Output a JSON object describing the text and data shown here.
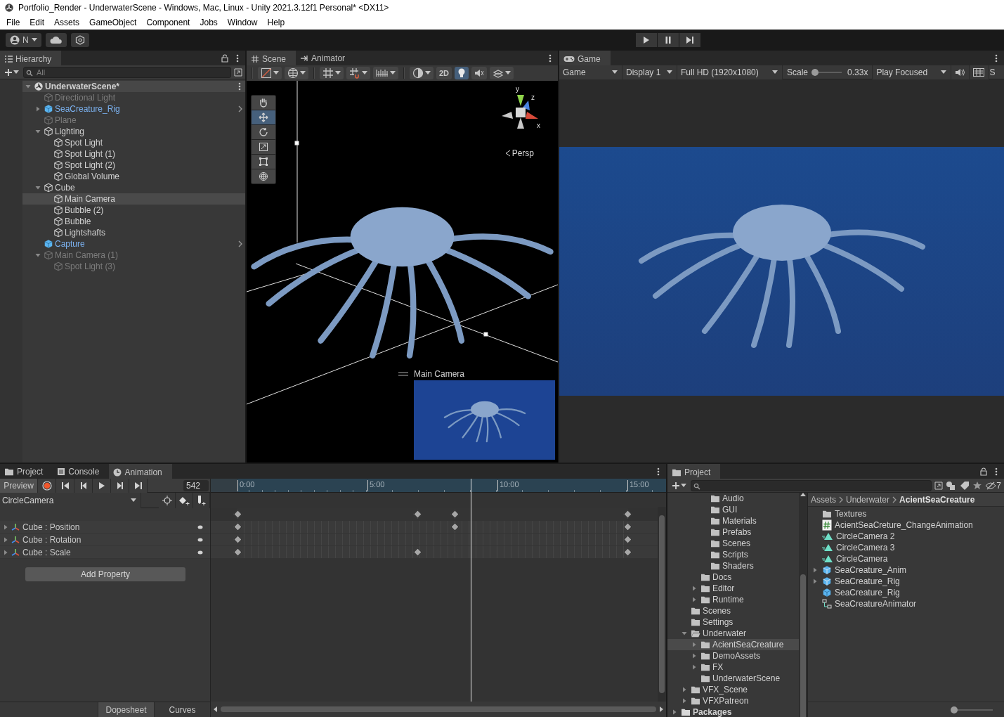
{
  "window": {
    "title": "Portfolio_Render - UnderwaterScene - Windows, Mac, Linux - Unity 2021.3.12f1 Personal* <DX11>"
  },
  "menu": [
    "File",
    "Edit",
    "Assets",
    "GameObject",
    "Component",
    "Jobs",
    "Window",
    "Help"
  ],
  "toolbar": {
    "account": "N",
    "play_controls": [
      {
        "kind": "play"
      },
      {
        "kind": "pause"
      },
      {
        "kind": "step"
      }
    ]
  },
  "hierarchy": {
    "title": "Hierarchy",
    "search": {
      "placeholder": "All"
    },
    "scene": {
      "label": "UnderwaterScene*",
      "expanded": true
    },
    "items": [
      {
        "label": "Directional Light",
        "kind": "object",
        "disabled": true,
        "selected": false
      },
      {
        "label": "SeaCreature_Rig",
        "kind": "prefab",
        "disabled": false,
        "selected": false,
        "expanded": false
      },
      {
        "label": "Plane",
        "kind": "object",
        "disabled": true,
        "selected": false
      },
      {
        "label": "Lighting",
        "kind": "object",
        "disabled": false,
        "selected": false,
        "expanded": true,
        "children": [
          {
            "label": "Spot Light",
            "kind": "object",
            "disabled": false,
            "selected": false
          },
          {
            "label": "Spot Light (1)",
            "kind": "object",
            "disabled": false,
            "selected": false
          },
          {
            "label": "Spot Light (2)",
            "kind": "object",
            "disabled": false,
            "selected": false
          },
          {
            "label": "Global Volume",
            "kind": "object",
            "disabled": false,
            "selected": false
          }
        ]
      },
      {
        "label": "Cube",
        "kind": "object",
        "disabled": false,
        "selected": false,
        "expanded": true,
        "children": [
          {
            "label": "Main Camera",
            "kind": "object",
            "disabled": false,
            "selected": true
          },
          {
            "label": "Bubble (2)",
            "kind": "object",
            "disabled": false,
            "selected": false
          },
          {
            "label": "Bubble",
            "kind": "object",
            "disabled": false,
            "selected": false
          },
          {
            "label": "Lightshafts",
            "kind": "object",
            "disabled": false,
            "selected": false
          }
        ]
      },
      {
        "label": "Capture",
        "kind": "prefab",
        "disabled": false,
        "selected": false
      },
      {
        "label": "Main Camera (1)",
        "kind": "object",
        "disabled": true,
        "selected": false,
        "expanded": true,
        "children": [
          {
            "label": "Spot Light (3)",
            "kind": "object",
            "disabled": true,
            "selected": false
          }
        ]
      }
    ]
  },
  "scene_view": {
    "tabs": [
      {
        "label": "Scene",
        "kind": "scene",
        "selected": true
      },
      {
        "label": "Animator",
        "kind": "animator",
        "selected": false
      }
    ],
    "toolbar": {
      "mode_2d": "2D",
      "lighting_on": true
    },
    "tools": [
      {
        "kind": "hand",
        "selected": false
      },
      {
        "kind": "move",
        "selected": true
      },
      {
        "kind": "rotate",
        "selected": false
      },
      {
        "kind": "scale",
        "selected": false
      },
      {
        "kind": "rect",
        "selected": false
      },
      {
        "kind": "transform",
        "selected": false
      }
    ],
    "gizmo": {
      "axes": [
        "y",
        "z",
        "x"
      ],
      "projection": "Persp"
    },
    "camera_preview": {
      "label": "Main Camera"
    }
  },
  "game_view": {
    "tabs": [
      {
        "label": "Game",
        "selected": true
      }
    ],
    "toolbar": {
      "view": "Game",
      "display": "Display 1",
      "resolution": "Full HD (1920x1080)",
      "scale_label": "Scale",
      "scale": {
        "level": 0.05
      },
      "scale_value": "0.33x",
      "play_mode": "Play Focused",
      "cut_label": "S"
    }
  },
  "animation": {
    "tabs": [
      {
        "label": "Project",
        "kind": "folder",
        "selected": false
      },
      {
        "label": "Console",
        "kind": "console",
        "selected": false
      },
      {
        "label": "Animation",
        "kind": "animation",
        "selected": true
      }
    ],
    "preview": "Preview",
    "frame": "542",
    "clip": "CircleCamera",
    "ruler": [
      "0:00",
      "5:00",
      "10:00",
      "15:00"
    ],
    "playhead": {
      "level": 0.598
    },
    "summary_keys": [
      {
        "level": 0
      },
      {
        "level": 0.463
      },
      {
        "level": 0.557
      },
      {
        "level": 1
      }
    ],
    "properties": [
      {
        "label": "Cube : Position",
        "keys": [
          {
            "level": 0
          },
          {
            "level": 0.557
          },
          {
            "level": 1
          }
        ]
      },
      {
        "label": "Cube : Rotation",
        "keys": [
          {
            "level": 0
          },
          {
            "level": 1
          }
        ]
      },
      {
        "label": "Cube : Scale",
        "keys": [
          {
            "level": 0
          },
          {
            "level": 0.463
          },
          {
            "level": 1
          }
        ]
      }
    ],
    "add_property": "Add Property",
    "modes": [
      {
        "label": "Dopesheet",
        "selected": true
      },
      {
        "label": "Curves",
        "selected": false
      }
    ]
  },
  "project": {
    "tabs": [
      {
        "label": "Project",
        "selected": true
      }
    ],
    "hidden_count": "7",
    "folders": [
      {
        "children": [
          {
            "children": [
              {
                "children": [
                  {
                    "label": "Audio",
                    "kind": "folder",
                    "selected": false
                  },
                  {
                    "label": "GUI",
                    "kind": "folder",
                    "selected": false
                  },
                  {
                    "label": "Materials",
                    "kind": "folder",
                    "selected": false
                  },
                  {
                    "label": "Prefabs",
                    "kind": "folder",
                    "selected": false
                  },
                  {
                    "label": "Scenes",
                    "kind": "folder",
                    "selected": false
                  },
                  {
                    "label": "Scripts",
                    "kind": "folder",
                    "selected": false
                  },
                  {
                    "label": "Shaders",
                    "kind": "folder",
                    "selected": false
                  }
                ]
              },
              {
                "label": "Docs",
                "kind": "folder",
                "selected": false
              },
              {
                "label": "Editor",
                "kind": "folder",
                "selected": false,
                "expanded": false
              },
              {
                "label": "Runtime",
                "kind": "folder",
                "selected": false,
                "expanded": false
              }
            ]
          },
          {
            "label": "Scenes",
            "kind": "folder",
            "selected": false
          },
          {
            "label": "Settings",
            "kind": "folder",
            "selected": false
          },
          {
            "label": "Underwater",
            "kind": "folder",
            "selected": false,
            "expanded": true,
            "children": [
              {
                "label": "AcientSeaCreature",
                "kind": "folder",
                "selected": true,
                "expanded": false
              },
              {
                "label": "DemoAssets",
                "kind": "folder",
                "selected": false,
                "expanded": false
              },
              {
                "label": "FX",
                "kind": "folder",
                "selected": false,
                "expanded": false
              },
              {
                "label": "UnderwaterScene",
                "kind": "folder",
                "selected": false
              }
            ]
          },
          {
            "label": "VFX_Scene",
            "kind": "folder",
            "selected": false,
            "expanded": false
          },
          {
            "label": "VFXPatreon",
            "kind": "folder",
            "selected": false,
            "expanded": false
          }
        ]
      },
      {
        "label": "Packages",
        "kind": "root",
        "selected": false,
        "expanded": false
      }
    ],
    "breadcrumb": [
      "Assets",
      "Underwater",
      "AcientSeaCreature"
    ],
    "assets": [
      {
        "label": "Textures",
        "kind": "folder"
      },
      {
        "label": "AcientSeaCreture_ChangeAnimation",
        "kind": "script"
      },
      {
        "label": "CircleCamera 2",
        "kind": "clip"
      },
      {
        "label": "CircleCamera 3",
        "kind": "clip"
      },
      {
        "label": "CircleCamera",
        "kind": "clip"
      },
      {
        "label": "SeaCreature_Anim",
        "kind": "model",
        "expanded": false
      },
      {
        "label": "SeaCreature_Rig",
        "kind": "model",
        "expanded": false
      },
      {
        "label": "SeaCreature_Rig",
        "kind": "prefab"
      },
      {
        "label": "SeaCreatureAnimator",
        "kind": "animator"
      }
    ],
    "icon_size": {
      "level": 0.05
    }
  }
}
